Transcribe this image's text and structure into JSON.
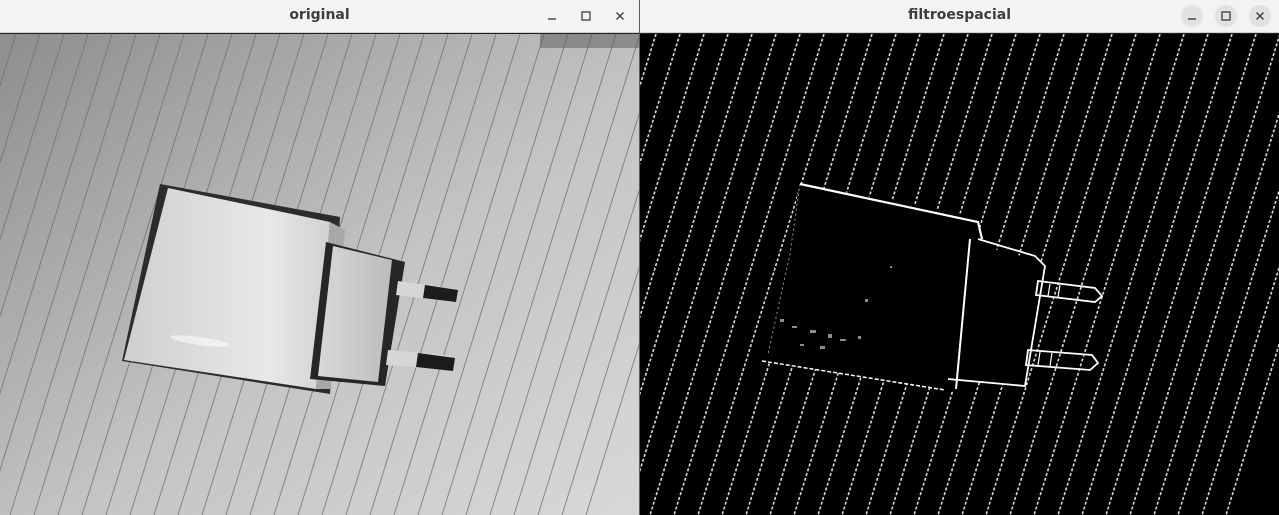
{
  "windows": [
    {
      "title": "original",
      "controls": {
        "minimize": "minimize-icon",
        "maximize": "maximize-icon",
        "close": "close-icon"
      },
      "content": "grayscale photo of a white two-pin power adapter on lined paper"
    },
    {
      "title": "filtroespacial",
      "controls": {
        "minimize": "minimize-icon",
        "maximize": "maximize-icon",
        "close": "close-icon"
      },
      "content": "edge-filtered version of the same photo, white edges on black"
    }
  ],
  "colors": {
    "titlebar": "#f3f3f3",
    "title_text": "#3d3d3d",
    "paper": "#b9b9b9",
    "edge_bg": "#000000",
    "edge_line": "#ffffff"
  }
}
